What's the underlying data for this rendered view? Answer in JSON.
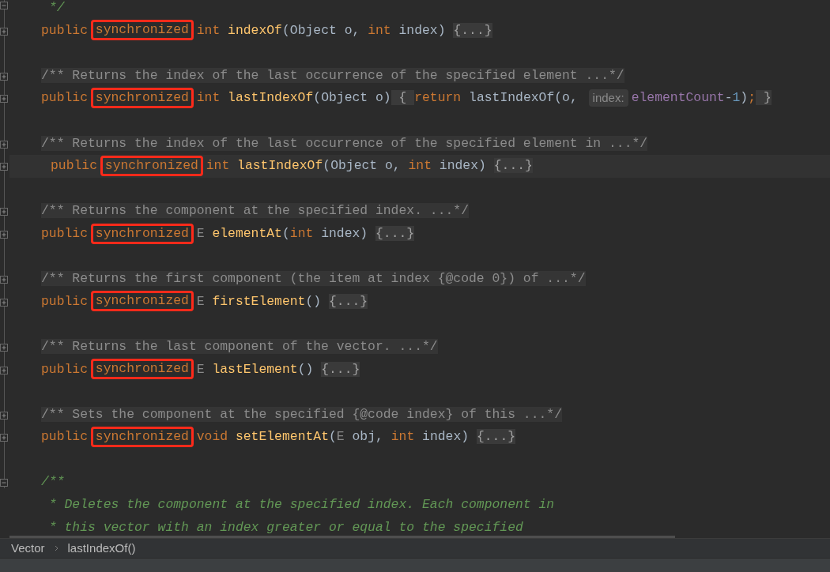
{
  "editor": {
    "lines": [
      {
        "current": false,
        "kind": "fold_end",
        "tokens": [
          {
            "text": " */",
            "kind": "javadoc"
          }
        ]
      },
      {
        "current": false,
        "kind": "fold_collapsed",
        "tokens": [
          {
            "text": "public ",
            "kind": "keyword"
          },
          {
            "text": "synchronized",
            "kind": "keyword",
            "boxed": true
          },
          {
            "text": " int ",
            "kind": "keyword"
          },
          {
            "text": "indexOf",
            "kind": "method"
          },
          {
            "text": "(Object o, ",
            "kind": "plain"
          },
          {
            "text": "int ",
            "kind": "keyword"
          },
          {
            "text": "index) ",
            "kind": "plain"
          },
          {
            "text": "{...}",
            "kind": "folded"
          }
        ]
      },
      {
        "current": false,
        "kind": "blank"
      },
      {
        "current": false,
        "kind": "fold_collapsed",
        "tokens": [
          {
            "text": "/** Returns the index of the last occurrence of the specified element ...*/",
            "kind": "folded_doc"
          }
        ]
      },
      {
        "current": false,
        "kind": "fold_collapsed",
        "tokens": [
          {
            "text": "public ",
            "kind": "keyword"
          },
          {
            "text": "synchronized",
            "kind": "keyword",
            "boxed": true
          },
          {
            "text": " int ",
            "kind": "keyword"
          },
          {
            "text": "lastIndexOf",
            "kind": "method"
          },
          {
            "text": "(Object o)",
            "kind": "plain"
          },
          {
            "text": " { ",
            "kind": "folded"
          },
          {
            "text": "return ",
            "kind": "keyword"
          },
          {
            "text": "lastIndexOf(o, ",
            "kind": "plain"
          },
          {
            "text": "index:",
            "kind": "hint"
          },
          {
            "text": "elementCount",
            "kind": "field"
          },
          {
            "text": "-",
            "kind": "plain"
          },
          {
            "text": "1",
            "kind": "number"
          },
          {
            "text": ")",
            "kind": "plain"
          },
          {
            "text": ";",
            "kind": "keyword"
          },
          {
            "text": " }",
            "kind": "folded"
          }
        ]
      },
      {
        "current": false,
        "kind": "blank"
      },
      {
        "current": false,
        "kind": "fold_collapsed",
        "tokens": [
          {
            "text": "/** Returns the index of the last occurrence of the specified element in ...*/",
            "kind": "folded_doc"
          }
        ]
      },
      {
        "current": true,
        "kind": "fold_collapsed",
        "tokens": [
          {
            "text": "public ",
            "kind": "keyword"
          },
          {
            "text": "synchronized",
            "kind": "keyword",
            "boxed": true
          },
          {
            "text": " int ",
            "kind": "keyword"
          },
          {
            "text": "lastIndexOf",
            "kind": "method"
          },
          {
            "text": "(Object o, ",
            "kind": "plain"
          },
          {
            "text": "int ",
            "kind": "keyword"
          },
          {
            "text": "index) ",
            "kind": "plain"
          },
          {
            "text": "{...}",
            "kind": "folded"
          }
        ]
      },
      {
        "current": false,
        "kind": "blank"
      },
      {
        "current": false,
        "kind": "fold_collapsed",
        "tokens": [
          {
            "text": "/** Returns the component at the specified index. ...*/",
            "kind": "folded_doc"
          }
        ]
      },
      {
        "current": false,
        "kind": "fold_collapsed",
        "tokens": [
          {
            "text": "public ",
            "kind": "keyword"
          },
          {
            "text": "synchronized",
            "kind": "keyword",
            "boxed": true
          },
          {
            "text": " E ",
            "kind": "type_param"
          },
          {
            "text": "elementAt",
            "kind": "method"
          },
          {
            "text": "(",
            "kind": "plain"
          },
          {
            "text": "int ",
            "kind": "keyword"
          },
          {
            "text": "index) ",
            "kind": "plain"
          },
          {
            "text": "{...}",
            "kind": "folded"
          }
        ]
      },
      {
        "current": false,
        "kind": "blank"
      },
      {
        "current": false,
        "kind": "fold_collapsed",
        "tokens": [
          {
            "text": "/** Returns the first component (the item at index {@code 0}) of ...*/",
            "kind": "folded_doc"
          }
        ]
      },
      {
        "current": false,
        "kind": "fold_collapsed",
        "tokens": [
          {
            "text": "public ",
            "kind": "keyword"
          },
          {
            "text": "synchronized",
            "kind": "keyword",
            "boxed": true
          },
          {
            "text": " E ",
            "kind": "type_param"
          },
          {
            "text": "firstElement",
            "kind": "method"
          },
          {
            "text": "() ",
            "kind": "plain"
          },
          {
            "text": "{...}",
            "kind": "folded"
          }
        ]
      },
      {
        "current": false,
        "kind": "blank"
      },
      {
        "current": false,
        "kind": "fold_collapsed",
        "tokens": [
          {
            "text": "/** Returns the last component of the vector. ...*/",
            "kind": "folded_doc"
          }
        ]
      },
      {
        "current": false,
        "kind": "fold_collapsed",
        "tokens": [
          {
            "text": "public ",
            "kind": "keyword"
          },
          {
            "text": "synchronized",
            "kind": "keyword",
            "boxed": true
          },
          {
            "text": " E ",
            "kind": "type_param"
          },
          {
            "text": "lastElement",
            "kind": "method"
          },
          {
            "text": "() ",
            "kind": "plain"
          },
          {
            "text": "{...}",
            "kind": "folded"
          }
        ]
      },
      {
        "current": false,
        "kind": "blank"
      },
      {
        "current": false,
        "kind": "fold_collapsed",
        "tokens": [
          {
            "text": "/** Sets the component at the specified {@code index} of this ...*/",
            "kind": "folded_doc"
          }
        ]
      },
      {
        "current": false,
        "kind": "fold_collapsed",
        "tokens": [
          {
            "text": "public ",
            "kind": "keyword"
          },
          {
            "text": "synchronized",
            "kind": "keyword",
            "boxed": true
          },
          {
            "text": " void ",
            "kind": "keyword"
          },
          {
            "text": "setElementAt",
            "kind": "method"
          },
          {
            "text": "(",
            "kind": "plain"
          },
          {
            "text": "E",
            "kind": "type_param"
          },
          {
            "text": " obj, ",
            "kind": "plain"
          },
          {
            "text": "int ",
            "kind": "keyword"
          },
          {
            "text": "index) ",
            "kind": "plain"
          },
          {
            "text": "{...}",
            "kind": "folded"
          }
        ]
      },
      {
        "current": false,
        "kind": "blank"
      },
      {
        "current": false,
        "kind": "fold_start",
        "tokens": [
          {
            "text": "/**",
            "kind": "javadoc"
          }
        ]
      },
      {
        "current": false,
        "kind": "text",
        "tokens": [
          {
            "text": " * Deletes the component at the specified index. Each component in",
            "kind": "javadoc"
          }
        ]
      },
      {
        "current": false,
        "kind": "text",
        "tokens": [
          {
            "text": " * this vector with an index greater or equal to the specified",
            "kind": "javadoc"
          }
        ]
      }
    ]
  },
  "breadcrumbs": [
    "Vector",
    "lastIndexOf()"
  ]
}
